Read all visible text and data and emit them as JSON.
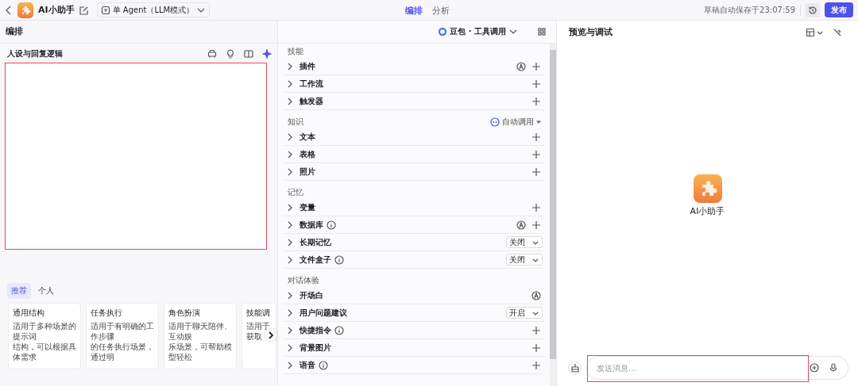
{
  "topbar": {
    "app_name": "AI小助手",
    "mode": "单 Agent（LLM模式）",
    "tabs": [
      {
        "label": "编排",
        "selected": true
      },
      {
        "label": "分析",
        "selected": false
      }
    ],
    "save_status": "草稿自动保存于23:07:59",
    "publish": "发布"
  },
  "left": {
    "title": "编排",
    "section_title": "人设与回复逻辑",
    "prompt_highlighted": true,
    "template_tabs": [
      {
        "label": "推荐",
        "selected": true
      },
      {
        "label": "个人",
        "selected": false
      }
    ],
    "templates": [
      {
        "title": "通用结构",
        "lines": [
          "适用于多种场景的提示词",
          "结构，可以根据具体需求"
        ]
      },
      {
        "title": "任务执行",
        "lines": [
          "适用于有明确的工作步骤",
          "的任务执行场景，通过明"
        ]
      },
      {
        "title": "角色扮演",
        "lines": [
          "适用于聊天陪伴、互动娱",
          "乐场景，可帮助模型轻松"
        ]
      },
      {
        "title": "技能调",
        "lines": [
          "适用于",
          "获取"
        ]
      }
    ]
  },
  "middle": {
    "model": "豆包 · 工具调用",
    "sections": [
      {
        "title": "技能",
        "items": [
          {
            "label": "插件",
            "info": false,
            "auto": true,
            "kind": "plus"
          },
          {
            "label": "工作流",
            "info": false,
            "auto": false,
            "kind": "plus"
          },
          {
            "label": "触发器",
            "info": false,
            "auto": false,
            "kind": "plus"
          }
        ]
      },
      {
        "title": "知识",
        "action": "自动调用",
        "items": [
          {
            "label": "文本",
            "info": false,
            "auto": false,
            "kind": "plus"
          },
          {
            "label": "表格",
            "info": false,
            "auto": false,
            "kind": "plus"
          },
          {
            "label": "照片",
            "info": false,
            "auto": false,
            "kind": "plus"
          }
        ]
      },
      {
        "title": "记忆",
        "items": [
          {
            "label": "变量",
            "info": false,
            "auto": false,
            "kind": "plus"
          },
          {
            "label": "数据库",
            "info": true,
            "auto": true,
            "kind": "plus"
          },
          {
            "label": "长期记忆",
            "info": false,
            "auto": false,
            "kind": "select",
            "value": "关闭"
          },
          {
            "label": "文件盒子",
            "info": true,
            "auto": false,
            "kind": "select",
            "value": "关闭"
          }
        ]
      },
      {
        "title": "对话体验",
        "items": [
          {
            "label": "开场白",
            "info": false,
            "auto": true,
            "kind": "none"
          },
          {
            "label": "用户问题建议",
            "info": false,
            "auto": false,
            "kind": "select",
            "value": "开启"
          },
          {
            "label": "快捷指令",
            "info": true,
            "auto": false,
            "kind": "plus"
          },
          {
            "label": "背景图片",
            "info": false,
            "auto": false,
            "kind": "plus"
          },
          {
            "label": "语音",
            "info": true,
            "auto": false,
            "kind": "plus"
          }
        ]
      }
    ]
  },
  "preview": {
    "title": "预览与调试",
    "bot_name": "AI小助手",
    "input_placeholder": "发送消息...",
    "input_highlighted": true
  }
}
